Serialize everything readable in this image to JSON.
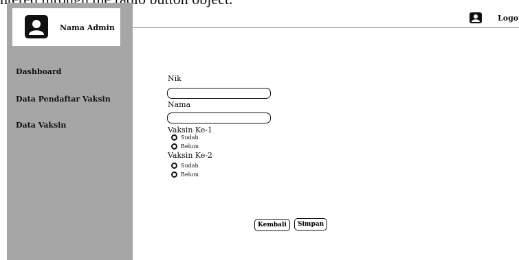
{
  "caption": "ntered through the radio button object.",
  "sidebar": {
    "admin_name": "Nama Admin",
    "items": [
      {
        "label": "Dashboard"
      },
      {
        "label": "Data Pendaftar Vaksin"
      },
      {
        "label": "Data Vaksin"
      }
    ]
  },
  "header": {
    "logout_label": "Logou",
    "user_icon": "user-icon"
  },
  "form": {
    "nik_label": "Nik",
    "nik_value": "",
    "nama_label": "Nama",
    "nama_value": "",
    "vaksin1": {
      "label": "Vaksin Ke-1",
      "options": [
        "Sudah",
        "Belum"
      ]
    },
    "vaksin2": {
      "label": "Vaksin Ke-2",
      "options": [
        "Sudah",
        "Belum"
      ]
    },
    "kembali_label": "Kembali",
    "simpan_label": "Simpan"
  }
}
